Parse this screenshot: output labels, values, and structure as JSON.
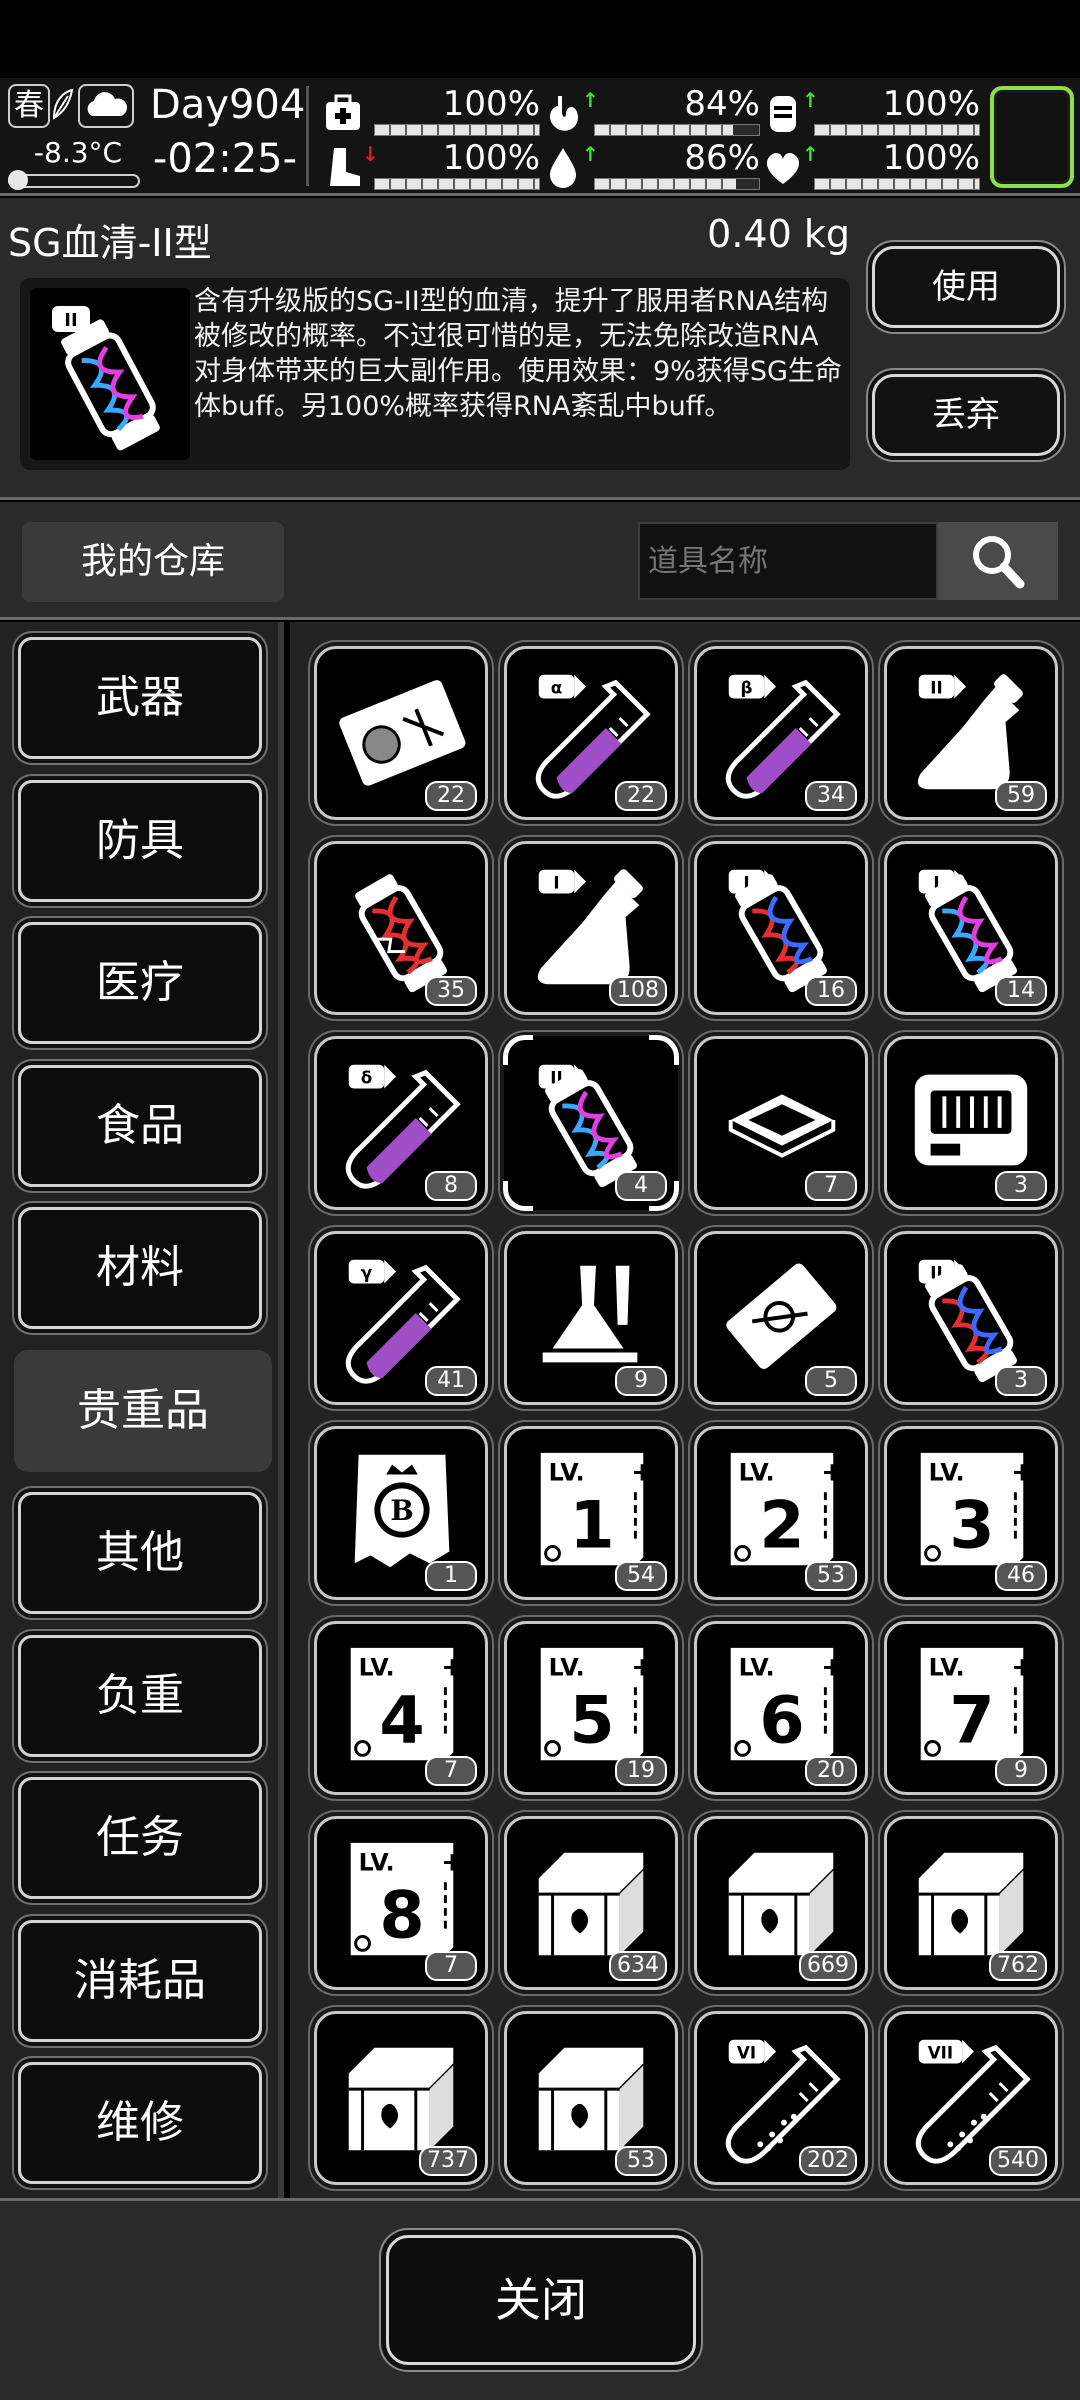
{
  "status": {
    "season": "春",
    "temperature": "-8.3°C",
    "day": "Day904",
    "time": "-02:25-",
    "stats": [
      {
        "icon": "medkit-icon",
        "value": "100%",
        "trend": "",
        "level": 1.0
      },
      {
        "icon": "stomach-icon",
        "value": "84%",
        "trend": "up",
        "level": 0.84
      },
      {
        "icon": "energy-drink-icon",
        "value": "100%",
        "trend": "up",
        "level": 1.0
      },
      {
        "icon": "boot-icon",
        "value": "100%",
        "trend": "down",
        "level": 1.0
      },
      {
        "icon": "water-drop-icon",
        "value": "86%",
        "trend": "up",
        "level": 0.86
      },
      {
        "icon": "heart-icon",
        "value": "100%",
        "trend": "up",
        "level": 1.0
      }
    ],
    "colors": {
      "up": "#3ee03e",
      "down": "#e02020",
      "slot_border": "#8ee04a"
    }
  },
  "detail": {
    "name": "SG血清-II型",
    "weight": "0.40 kg",
    "badge": "II",
    "description": "含有升级版的SG-II型的血清，提升了服用者RNA结构被修改的概率。不过很可惜的是，无法免除改造RNA对身体带来的巨大副作用。使用效果：9%获得SG生命体buff。另100%概率获得RNA紊乱中buff。",
    "use_label": "使用",
    "drop_label": "丢弃"
  },
  "warehouse": {
    "title": "我的仓库",
    "search_placeholder": "道具名称"
  },
  "categories": [
    {
      "label": "武器"
    },
    {
      "label": "防具"
    },
    {
      "label": "医疗"
    },
    {
      "label": "食品"
    },
    {
      "label": "材料"
    },
    {
      "label": "贵重品",
      "active": true
    },
    {
      "label": "其他"
    },
    {
      "label": "负重"
    },
    {
      "label": "任务"
    },
    {
      "label": "消耗品"
    },
    {
      "label": "维修"
    }
  ],
  "items": [
    {
      "kind": "card",
      "count": "22"
    },
    {
      "kind": "tube",
      "badge": "α",
      "fill": "purple",
      "count": "22"
    },
    {
      "kind": "tube",
      "badge": "β",
      "fill": "purple",
      "count": "34"
    },
    {
      "kind": "flask",
      "badge": "II",
      "count": "59"
    },
    {
      "kind": "vial-broken",
      "count": "35"
    },
    {
      "kind": "flask",
      "badge": "I",
      "count": "108"
    },
    {
      "kind": "vial",
      "badge": "I",
      "dna": "red",
      "count": "16"
    },
    {
      "kind": "vial",
      "badge": "I",
      "dna": "blue",
      "count": "14"
    },
    {
      "kind": "tube",
      "badge": "δ",
      "fill": "purple",
      "count": "8"
    },
    {
      "kind": "vial",
      "badge": "II",
      "dna": "blue",
      "count": "4",
      "selected": true
    },
    {
      "kind": "chip",
      "count": "7"
    },
    {
      "kind": "device",
      "count": "3"
    },
    {
      "kind": "tube",
      "badge": "γ",
      "fill": "purple",
      "count": "41"
    },
    {
      "kind": "burner",
      "count": "9"
    },
    {
      "kind": "ticket",
      "count": "5"
    },
    {
      "kind": "vial",
      "badge": "II",
      "dna": "red",
      "count": "3"
    },
    {
      "kind": "coin",
      "count": "1"
    },
    {
      "kind": "book",
      "level": "1",
      "count": "54"
    },
    {
      "kind": "book",
      "level": "2",
      "count": "53"
    },
    {
      "kind": "book",
      "level": "3",
      "count": "46"
    },
    {
      "kind": "book",
      "level": "4",
      "count": "7"
    },
    {
      "kind": "book",
      "level": "5",
      "count": "19"
    },
    {
      "kind": "book",
      "level": "6",
      "count": "20"
    },
    {
      "kind": "book",
      "level": "7",
      "count": "9"
    },
    {
      "kind": "book",
      "level": "8",
      "count": "7"
    },
    {
      "kind": "chest",
      "count": "634"
    },
    {
      "kind": "chest",
      "count": "669"
    },
    {
      "kind": "chest",
      "count": "762"
    },
    {
      "kind": "chest",
      "count": "737"
    },
    {
      "kind": "chest",
      "count": "53"
    },
    {
      "kind": "tube",
      "badge": "VI",
      "fill": "dots",
      "count": "202"
    },
    {
      "kind": "tube",
      "badge": "VII",
      "fill": "dots",
      "count": "540"
    }
  ],
  "close_label": "关闭"
}
